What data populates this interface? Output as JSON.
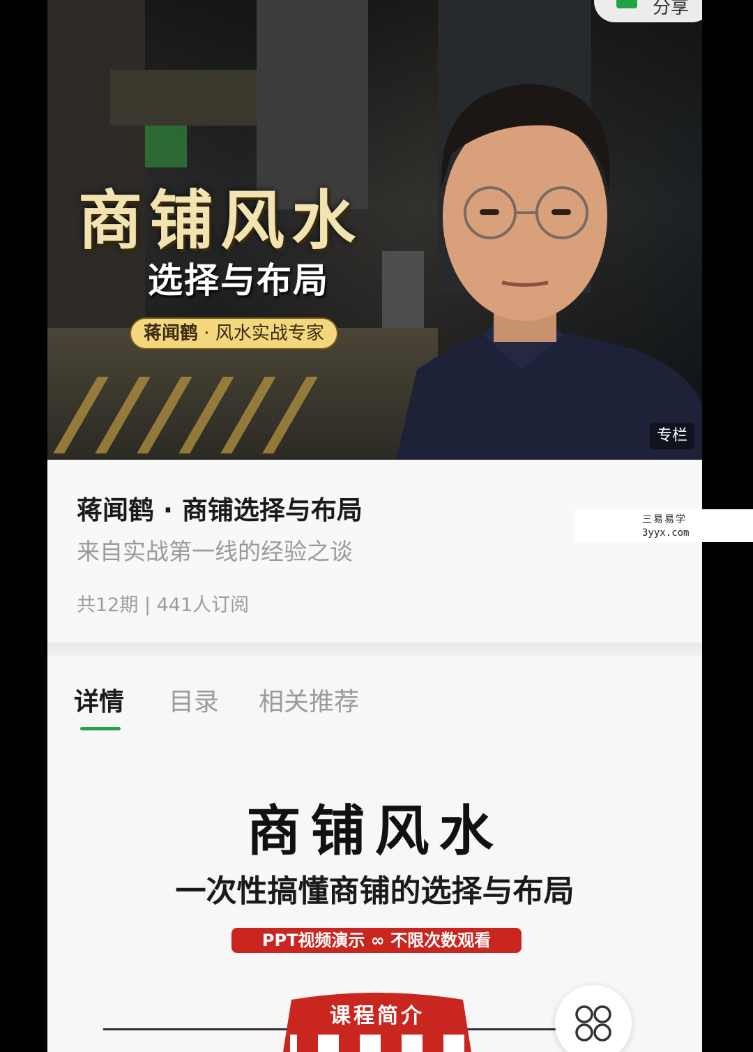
{
  "hero": {
    "share_label": "分享",
    "title": "商铺风水",
    "subtitle": "选择与布局",
    "author_name": "蒋闻鹤",
    "author_separator": "·",
    "author_role": "风水实战专家",
    "badge": "专栏"
  },
  "course": {
    "title": "蒋闻鹤 · 商铺选择与布局",
    "description": "来自实战第一线的经验之谈",
    "stats": "共12期 | 441人订阅"
  },
  "tabs": [
    {
      "label": "详情",
      "active": true
    },
    {
      "label": "目录",
      "active": false
    },
    {
      "label": "相关推荐",
      "active": false
    }
  ],
  "detail": {
    "title": "商铺风水",
    "subtitle": "一次性搞懂商铺的选择与布局",
    "banner": "PPT视频演示 ∞ 不限次数观看",
    "section_title": "课程简介"
  },
  "watermark": {
    "line1": "三易易学",
    "line2": "3yyx.com"
  },
  "colors": {
    "accent": "#22a348",
    "banner_red": "#c9261f",
    "author_pill": "#f3d77d"
  },
  "icons": {
    "float_button": "grid-icon",
    "share": "wechat-share-icon"
  }
}
